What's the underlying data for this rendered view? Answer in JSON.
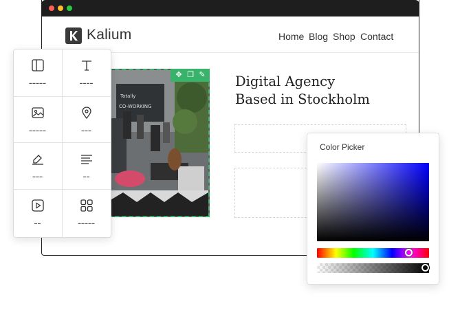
{
  "site": {
    "logo_text": "Kalium",
    "nav": [
      "Home",
      "Blog",
      "Shop",
      "Contact"
    ]
  },
  "hero": {
    "title_line1": "Digital Agency",
    "title_line2": "Based in Stockholm"
  },
  "image_toolbar": {
    "icons": [
      "move-icon",
      "copy-icon",
      "edit-icon"
    ]
  },
  "widgets": {
    "items": [
      {
        "icon": "columns-icon"
      },
      {
        "icon": "text-icon"
      },
      {
        "icon": "image-icon"
      },
      {
        "icon": "map-pin-icon"
      },
      {
        "icon": "pen-icon"
      },
      {
        "icon": "align-icon"
      },
      {
        "icon": "video-icon"
      },
      {
        "icon": "grid-icon"
      }
    ]
  },
  "color_picker": {
    "title": "Color Picker",
    "hue_fraction": 0.84,
    "alpha_fraction": 1.0,
    "selected_color": "#0000ff"
  },
  "colors": {
    "accent": "#39b36b",
    "titlebar": "#1e1e1e"
  }
}
